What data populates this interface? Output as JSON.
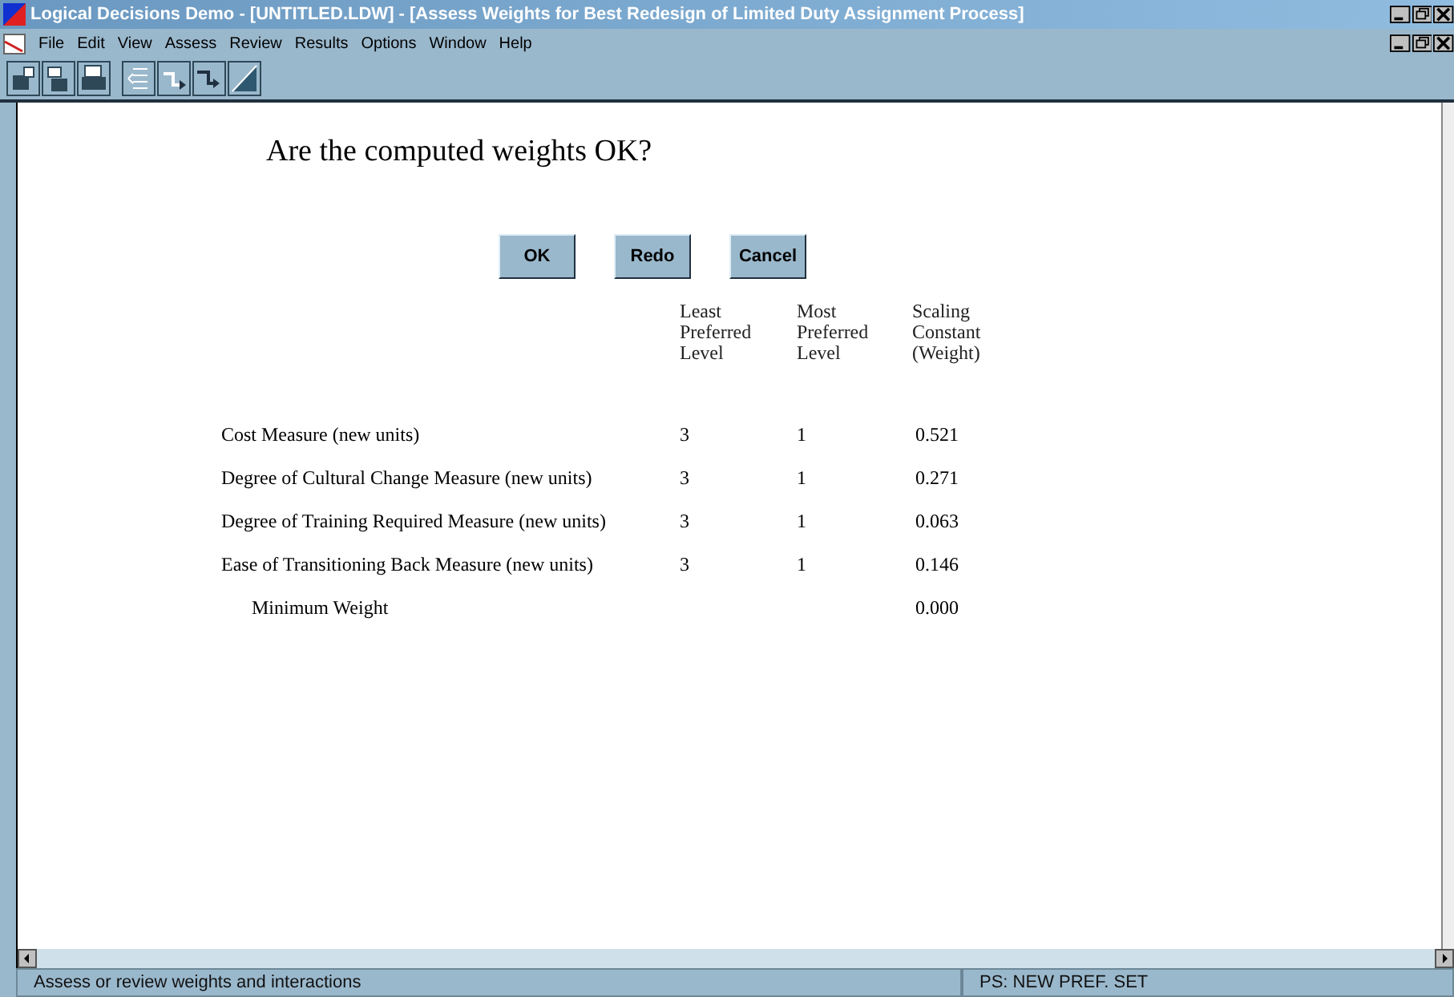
{
  "window": {
    "title": "Logical Decisions Demo - [UNTITLED.LDW] - [Assess Weights for Best Redesign of Limited Duty Assignment Process]"
  },
  "menu": [
    "File",
    "Edit",
    "View",
    "Assess",
    "Review",
    "Results",
    "Options",
    "Window",
    "Help"
  ],
  "question": "Are the computed weights OK?",
  "buttons": [
    "OK",
    "Redo",
    "Cancel"
  ],
  "table": {
    "columns": [
      "Least\nPreferred\nLevel",
      "Most\nPreferred\nLevel",
      "Scaling\nConstant\n(Weight)"
    ],
    "rows": [
      {
        "kind": "measure",
        "name": "Cost Measure (new units)",
        "least": "3",
        "most": "1",
        "weight": "0.521"
      },
      {
        "kind": "measure",
        "name": "Degree of Cultural Change Measure (new units)",
        "least": "3",
        "most": "1",
        "weight": "0.271"
      },
      {
        "kind": "measure",
        "name": "Degree of Training Required Measure (new units)",
        "least": "3",
        "most": "1",
        "weight": "0.063"
      },
      {
        "kind": "measure",
        "name": "Ease of Transitioning Back Measure (new units)",
        "least": "3",
        "most": "1",
        "weight": "0.146"
      },
      {
        "kind": "summary",
        "name": "Minimum Weight",
        "weight": "0.000"
      }
    ]
  },
  "status_bar": {
    "message": "Assess or review weights and interactions",
    "pref_set": "PS: NEW PREF. SET"
  }
}
